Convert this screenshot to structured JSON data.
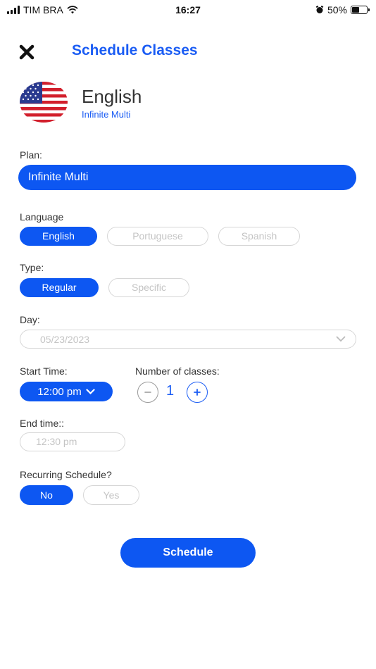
{
  "status_bar": {
    "carrier": "TIM BRA",
    "time": "16:27",
    "battery_percent": "50%",
    "battery_level": 0.5,
    "icons": [
      "signal-icon",
      "wifi-icon",
      "alarm-icon",
      "battery-icon"
    ]
  },
  "header": {
    "close_icon": "close-icon",
    "title": "Schedule Classes"
  },
  "course": {
    "flag_icon": "us-flag-icon",
    "name": "English",
    "plan": "Infinite Multi"
  },
  "plan": {
    "label": "Plan:",
    "value": "Infinite Multi"
  },
  "language": {
    "label": "Language",
    "options": [
      "English",
      "Portuguese",
      "Spanish"
    ],
    "selected": "English"
  },
  "type": {
    "label": "Type:",
    "options": [
      "Regular",
      "Specific"
    ],
    "selected": "Regular"
  },
  "day": {
    "label": "Day:",
    "value": "05/23/2023",
    "icon": "chevron-down-icon"
  },
  "start_time": {
    "label": "Start Time:",
    "value": "12:00 pm",
    "icon": "chevron-down-icon"
  },
  "number_of_classes": {
    "label": "Number of classes:",
    "value": "1",
    "minus_icon": "minus-icon",
    "plus_icon": "plus-icon"
  },
  "end_time": {
    "label": "End time::",
    "value": "12:30 pm"
  },
  "recurring": {
    "label": "Recurring Schedule?",
    "options": [
      "No",
      "Yes"
    ],
    "selected": "No"
  },
  "schedule_button": "Schedule",
  "colors": {
    "primary": "#0d57f2",
    "title_blue": "#1a5cf4",
    "inactive_border": "#d6d6d6",
    "inactive_text": "#c4c4c4"
  }
}
